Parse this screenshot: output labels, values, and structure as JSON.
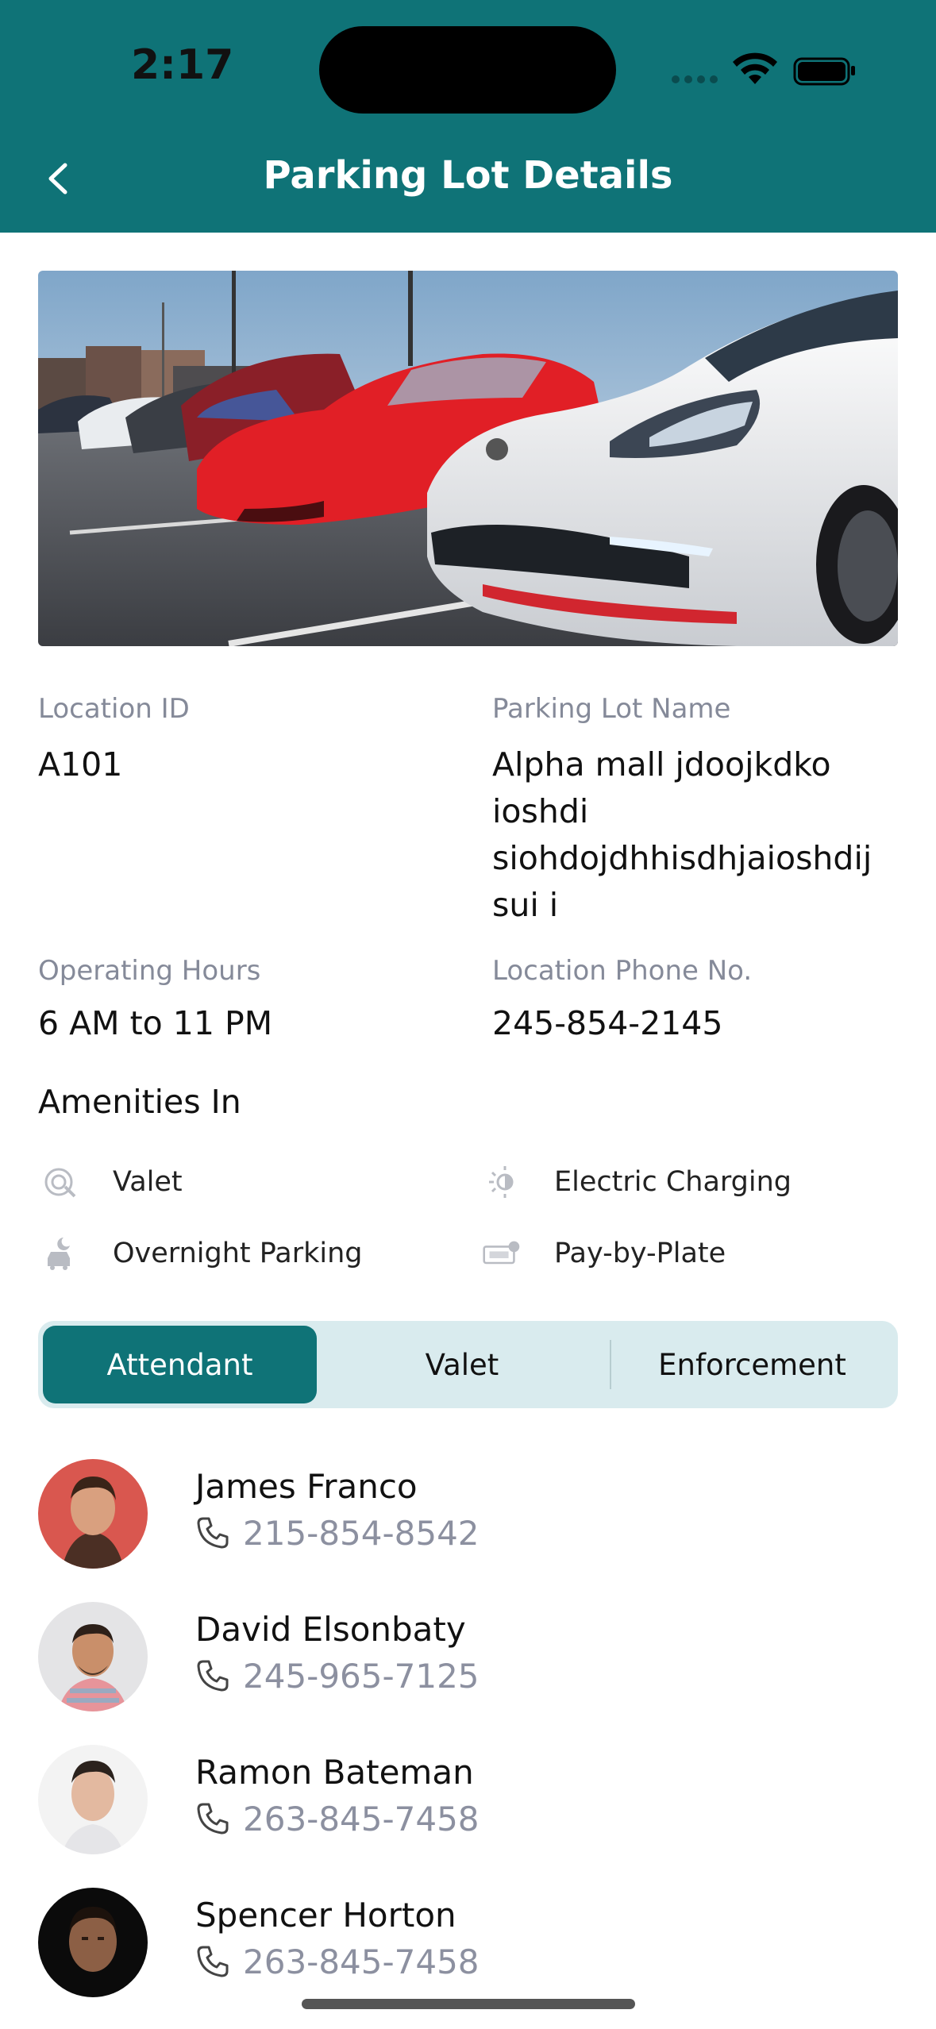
{
  "status_bar": {
    "time": "2:17"
  },
  "nav": {
    "title": "Parking Lot Details"
  },
  "hero": {
    "alt": "sports cars parked in a lot"
  },
  "details": {
    "location_id_label": "Location ID",
    "location_id_value": "A101",
    "lot_name_label": "Parking Lot Name",
    "lot_name_value": "Alpha mall jdoojkdko ioshdi siohdojdhhisdhjaioshdij sui i",
    "hours_label": "Operating Hours",
    "hours_value": "6 AM to 11 PM",
    "phone_label": "Location Phone No.",
    "phone_value": "245-854-2145"
  },
  "amenities": {
    "title": "Amenities In",
    "items": [
      {
        "label": "Valet",
        "icon": "valet-icon"
      },
      {
        "label": "Electric Charging",
        "icon": "electric-charging-icon"
      },
      {
        "label": "Overnight Parking",
        "icon": "overnight-parking-icon"
      },
      {
        "label": "Pay-by-Plate",
        "icon": "pay-by-plate-icon"
      }
    ]
  },
  "tabs": {
    "items": [
      {
        "label": "Attendant",
        "active": true
      },
      {
        "label": "Valet",
        "active": false
      },
      {
        "label": "Enforcement",
        "active": false
      }
    ]
  },
  "people": [
    {
      "name": "James Franco",
      "phone": "215-854-8542"
    },
    {
      "name": "David Elsonbaty",
      "phone": "245-965-7125"
    },
    {
      "name": "Ramon Bateman",
      "phone": "263-845-7458"
    },
    {
      "name": "Spencer Horton",
      "phone": "263-845-7458"
    }
  ],
  "colors": {
    "primary": "#0f7377",
    "segment_bg": "#d9ebee",
    "label_gray": "#858a99",
    "phone_gray": "#8c90a0"
  }
}
